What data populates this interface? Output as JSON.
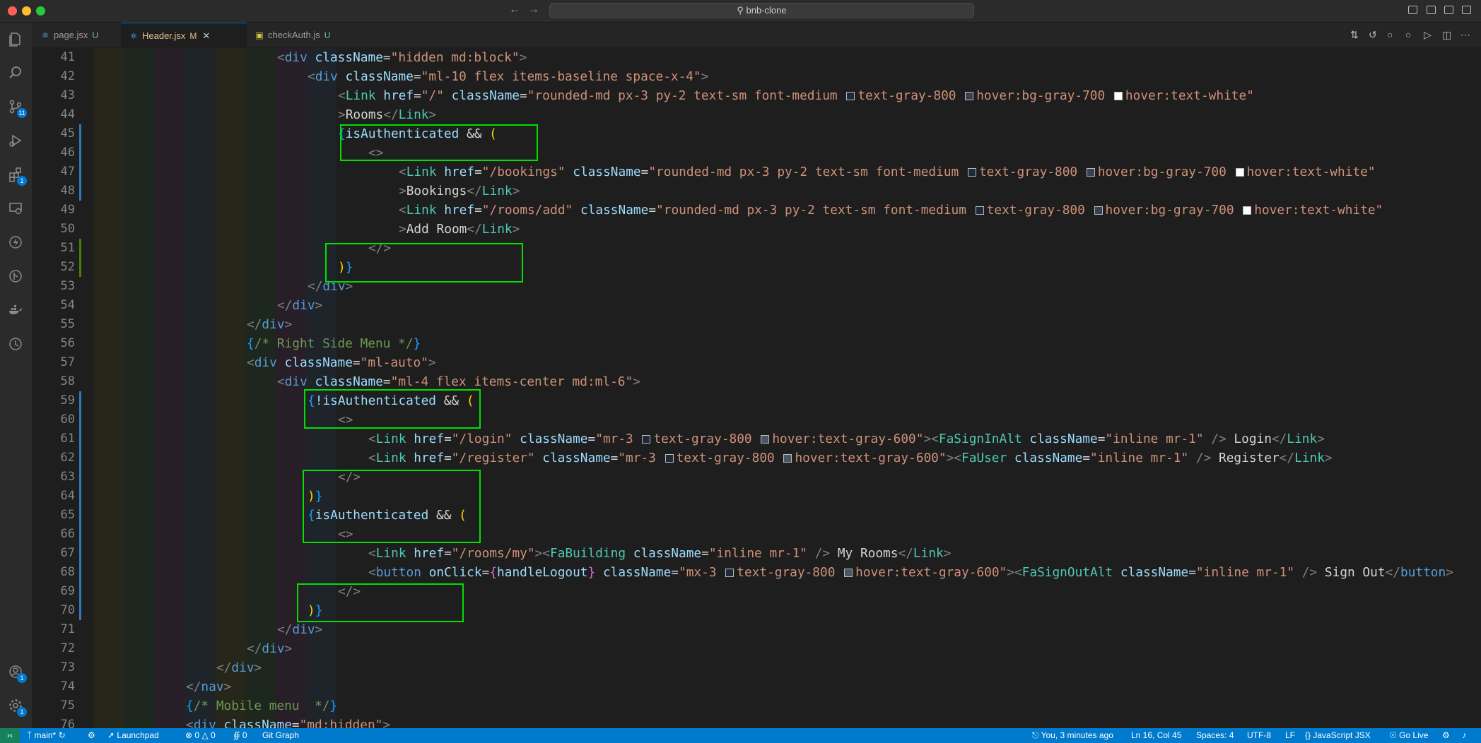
{
  "window": {
    "title": "bnb-clone"
  },
  "colors": {
    "accent": "#0078d4",
    "statusbar": "#007acc",
    "highlight_box": "#00e000"
  },
  "tabs": [
    {
      "label": "page.jsx",
      "status": "U",
      "icon": "react-icon",
      "active": false
    },
    {
      "label": "Header.jsx",
      "status": "M",
      "icon": "react-icon",
      "active": true
    },
    {
      "label": "checkAuth.js",
      "status": "U",
      "icon": "js-icon",
      "active": false
    }
  ],
  "activity_badges": {
    "source_control": "11",
    "extensions": "1",
    "accounts": "1",
    "settings": "1"
  },
  "line_numbers": [
    "41",
    "42",
    "43",
    "44",
    "45",
    "46",
    "47",
    "48",
    "49",
    "50",
    "51",
    "52",
    "53",
    "54",
    "55",
    "56",
    "57",
    "58",
    "59",
    "60",
    "61",
    "62",
    "63",
    "64",
    "65",
    "66",
    "67",
    "68",
    "69",
    "70",
    "71",
    "72",
    "73",
    "74",
    "75",
    "76"
  ],
  "code": {
    "l41": {
      "open": "<",
      "tag": "div",
      "attr": " className",
      "eq": "=",
      "str": "\"hidden md:block\"",
      "close": ">"
    },
    "l42": {
      "open": "<",
      "tag": "div",
      "attr": " className",
      "eq": "=",
      "str": "\"ml-10 flex items-baseline space-x-4\"",
      "close": ">"
    },
    "l43": {
      "open": "<",
      "comp": "Link",
      "attr1": " href",
      "eq": "=",
      "str1": "\"/\"",
      "attr2": " className",
      "str2a": "\"rounded-md px-3 py-2 text-sm font-medium ",
      "c1": "text-gray-800 ",
      "c2": "hover:bg-gray-700 ",
      "c3": "hover:text-white\""
    },
    "l44": {
      "close": ">",
      "text": "Rooms",
      "endopen": "</",
      "comp": "Link",
      "endclose": ">"
    },
    "l45": {
      "br": "{",
      "var": "isAuthenticated",
      "op": " && ",
      "paren": "("
    },
    "l46": {
      "frag": "<>"
    },
    "l47": {
      "open": "<",
      "comp": "Link",
      "attr1": " href",
      "eq": "=",
      "str1": "\"/bookings\"",
      "attr2": " className",
      "str2a": "\"rounded-md px-3 py-2 text-sm font-medium ",
      "c1": "text-gray-800 ",
      "c2": "hover:bg-gray-700 ",
      "c3": "hover:text-white\""
    },
    "l48": {
      "close": ">",
      "text": "Bookings",
      "endopen": "</",
      "comp": "Link",
      "endclose": ">"
    },
    "l49": {
      "open": "<",
      "comp": "Link",
      "attr1": " href",
      "eq": "=",
      "str1": "\"/rooms/add\"",
      "attr2": " className",
      "str2a": "\"rounded-md px-3 py-2 text-sm font-medium ",
      "c1": "text-gray-800 ",
      "c2": "hover:bg-gray-700 ",
      "c3": "hover:text-white\""
    },
    "l50": {
      "close": ">",
      "text": "Add Room",
      "endopen": "</",
      "comp": "Link",
      "endclose": ">"
    },
    "l51": {
      "frag": "</>"
    },
    "l52": {
      "paren": ")",
      "br": "}"
    },
    "l53": {
      "open": "</",
      "tag": "div",
      "close": ">"
    },
    "l54": {
      "open": "</",
      "tag": "div",
      "close": ">"
    },
    "l55": {
      "open": "</",
      "tag": "div",
      "close": ">"
    },
    "l56": {
      "br1": "{",
      "cmt": "/* Right Side Menu */",
      "br2": "}"
    },
    "l57": {
      "open": "<",
      "tag": "div",
      "attr": " className",
      "eq": "=",
      "str": "\"ml-auto\"",
      "close": ">"
    },
    "l58": {
      "open": "<",
      "tag": "div",
      "attr": " className",
      "eq": "=",
      "str": "\"ml-4 flex items-center md:ml-6\"",
      "close": ">"
    },
    "l59": {
      "br": "{",
      "var": "!isAuthenticated",
      "op": " && ",
      "paren": "("
    },
    "l60": {
      "frag": "<>"
    },
    "l61": {
      "open": "<",
      "comp": "Link",
      "attr1": " href",
      "eq": "=",
      "str1": "\"/login\"",
      "attr2": " className",
      "str2a": "\"mr-3 ",
      "c1": "text-gray-800 ",
      "c2": "hover:text-gray-600\"",
      "mid": "><",
      "comp2": "FaSignInAlt",
      "attr3": " className",
      "str3": "\"inline mr-1\"",
      "selfclose": " />",
      "text": " Login",
      "endopen": "</",
      "endcomp": "Link",
      "endclose": ">"
    },
    "l62": {
      "open": "<",
      "comp": "Link",
      "attr1": " href",
      "eq": "=",
      "str1": "\"/register\"",
      "attr2": " className",
      "str2a": "\"mr-3 ",
      "c1": "text-gray-800 ",
      "c2": "hover:text-gray-600\"",
      "mid": "><",
      "comp2": "FaUser",
      "attr3": " className",
      "str3": "\"inline mr-1\"",
      "selfclose": " />",
      "text": " Register",
      "endopen": "</",
      "endcomp": "Link",
      "endclose": ">"
    },
    "l63": {
      "frag": "</>"
    },
    "l64": {
      "paren": ")",
      "br": "}"
    },
    "l65": {
      "br": "{",
      "var": "isAuthenticated",
      "op": " && ",
      "paren": "("
    },
    "l66": {
      "frag": "<>"
    },
    "l67": {
      "open": "<",
      "comp": "Link",
      "attr1": " href",
      "eq": "=",
      "str1": "\"/rooms/my\"",
      "mid": "><",
      "comp2": "FaBuilding",
      "attr3": " className",
      "str3": "\"inline mr-1\"",
      "selfclose": " />",
      "text": " My Rooms",
      "endopen": "</",
      "endcomp": "Link",
      "endclose": ">"
    },
    "l68": {
      "open": "<",
      "tag": "button",
      "attr1": " onClick",
      "eq": "=",
      "br1": "{",
      "fn": "handleLogout",
      "br2": "}",
      "attr2": " className",
      "str2a": "\"mx-3 ",
      "c1": "text-gray-800 ",
      "c2": "hover:text-gray-600\"",
      "mid": "><",
      "comp2": "FaSignOutAlt",
      "attr3": " className",
      "str3": "\"inline mr-1\"",
      "selfclose": " />",
      "text": " Sign Out",
      "endopen": "</",
      "endtag": "button",
      "endclose": ">"
    },
    "l69": {
      "frag": "</>"
    },
    "l70": {
      "paren": ")",
      "br": "}"
    },
    "l71": {
      "open": "</",
      "tag": "div",
      "close": ">"
    },
    "l72": {
      "open": "</",
      "tag": "div",
      "close": ">"
    },
    "l73": {
      "open": "</",
      "tag": "div",
      "close": ">"
    },
    "l74": {
      "open": "</",
      "tag": "nav",
      "close": ">"
    },
    "l75": {
      "br1": "{",
      "cmt": "/* Mobile menu  */",
      "br2": "}"
    },
    "l76": {
      "open": "<",
      "tag": "div",
      "attr": " className",
      "eq": "=",
      "str": "\"md:hidden\"",
      "close": ">"
    }
  },
  "statusbar": {
    "branch": "main*",
    "launchpad": "Launchpad",
    "errors": "0",
    "warnings": "0",
    "ports": "0",
    "git_graph": "Git Graph",
    "blame": "You, 3 minutes ago",
    "cursor": "Ln 16, Col 45",
    "spaces": "Spaces: 4",
    "encoding": "UTF-8",
    "eol": "LF",
    "language": "JavaScript JSX",
    "golive": "Go Live"
  }
}
